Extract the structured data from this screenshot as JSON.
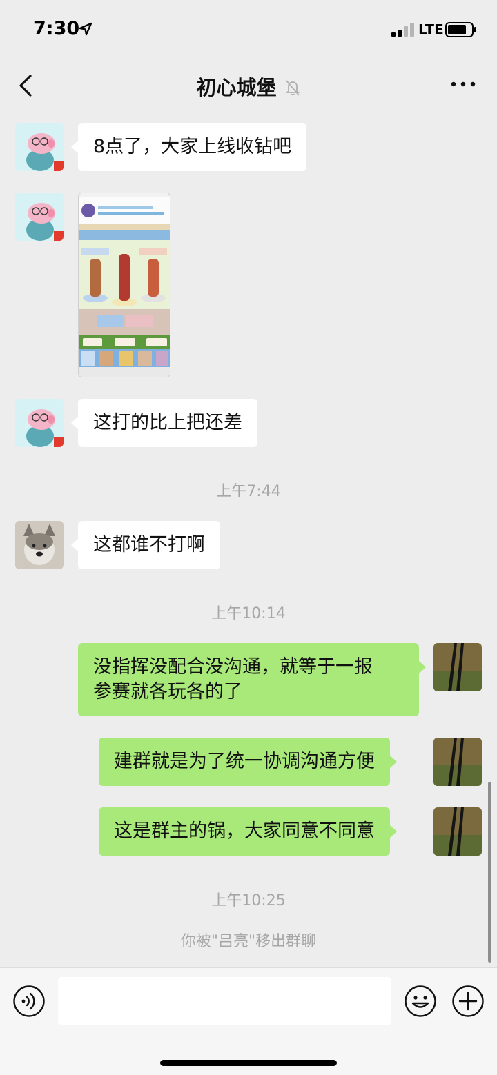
{
  "status_bar": {
    "time": "7:30",
    "network": "LTE"
  },
  "nav": {
    "title": "初心城堡"
  },
  "messages": [
    {
      "text": "8点了，大家上线收钻吧"
    },
    {
      "text": "这打的比上把还差"
    },
    {
      "text": "这都谁不打啊"
    },
    {
      "text": "没指挥没配合没沟通，就等于一报",
      "text2": "参赛就各玩各的了"
    },
    {
      "text": "建群就是为了统一协调沟通方便"
    },
    {
      "text": "这是群主的锅，大家同意不同意"
    }
  ],
  "timestamps": [
    "上午7:44",
    "上午10:14",
    "上午10:25"
  ],
  "system_message": "你被\"吕亮\"移出群聊",
  "icons": {
    "back": "chevron-left-icon",
    "mute": "bell-slash-icon",
    "more": "more-dots-icon",
    "voice": "voice-icon",
    "emoji": "emoji-icon",
    "plus": "plus-icon",
    "location": "location-arrow-icon"
  },
  "colors": {
    "background": "#ededed",
    "bubble_in": "#ffffff",
    "bubble_out": "#a9e97a",
    "timestamp": "#a6a6a6"
  }
}
